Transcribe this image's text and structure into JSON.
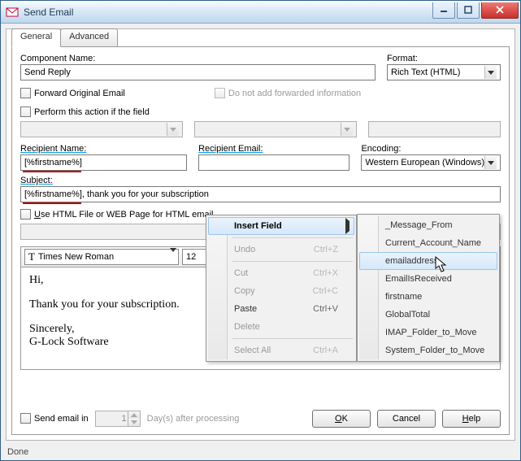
{
  "window": {
    "title": "Send Email"
  },
  "tabs": {
    "general": "General",
    "advanced": "Advanced"
  },
  "labels": {
    "componentName": "Component Name:",
    "format": "Format:",
    "forwardOriginal": "Forward Original Email",
    "doNotAdd": "Do not add forwarded information",
    "performAction": "Perform this action if the field",
    "recipientName": "Recipient Name:",
    "recipientEmail": "Recipient Email:",
    "encoding": "Encoding:",
    "subject": "Subject:",
    "useHtmlFile": "Use HTML File or WEB Page for HTML email",
    "sendEmailIn": "Send email in",
    "daysAfter": "Day(s) after processing"
  },
  "values": {
    "componentName": "Send Reply",
    "format": "Rich Text (HTML)",
    "recipientName": "[%firstname%]",
    "subject": "[%firstname%], thank you for your subscription",
    "encoding": "Western European (Windows)",
    "sendDays": "1",
    "fontName": "Times New Roman",
    "fontSize": "12"
  },
  "editor": {
    "line1": "Hi,",
    "line2": "Thank you for your subscription.",
    "line3": "Sincerely,",
    "line4": "G-Lock Software"
  },
  "buttons": {
    "ok": "OK",
    "cancel": "Cancel",
    "help": "Help"
  },
  "context": {
    "insertField": "Insert Field",
    "undo": "Undo",
    "cut": "Cut",
    "copy": "Copy",
    "paste": "Paste",
    "delete": "Delete",
    "selectAll": "Select All",
    "sc": {
      "undo": "Ctrl+Z",
      "cut": "Ctrl+X",
      "copy": "Ctrl+C",
      "paste": "Ctrl+V",
      "selectAll": "Ctrl+A"
    }
  },
  "fields": {
    "messageFrom": "_Message_From",
    "currentAccount": "Current_Account_Name",
    "emailaddress": "emailaddress",
    "emailIsReceived": "EmailIsReceived",
    "firstname": "firstname",
    "globalTotal": "GlobalTotal",
    "imapFolder": "IMAP_Folder_to_Move",
    "systemFolder": "System_Folder_to_Move"
  },
  "status": "Done"
}
